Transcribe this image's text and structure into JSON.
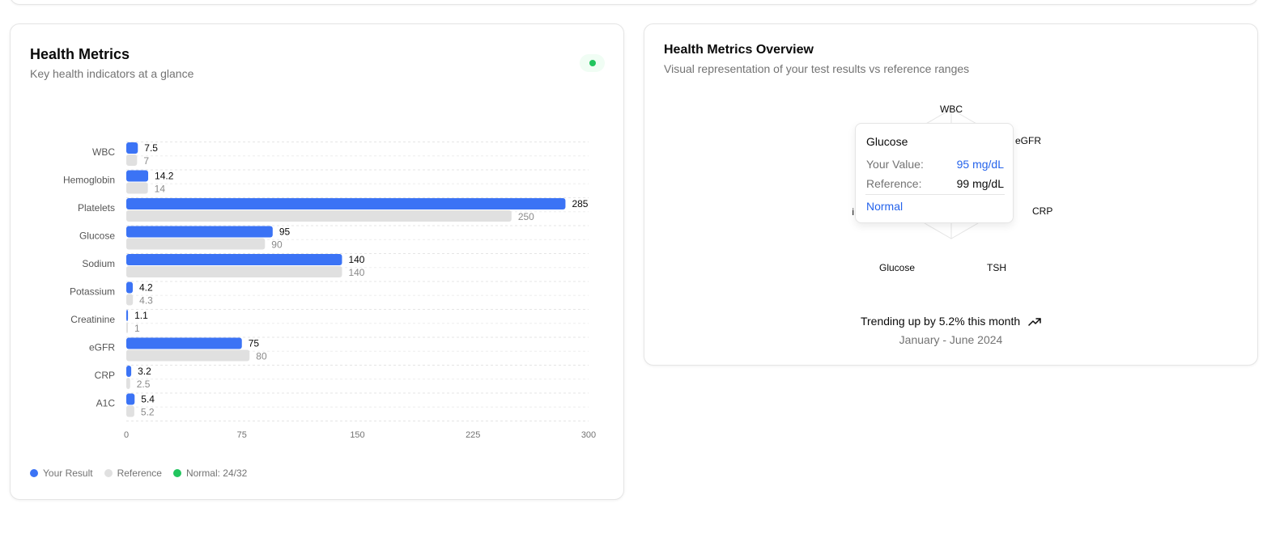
{
  "left_card": {
    "title": "Health Metrics",
    "description": "Key health indicators at a glance",
    "status_color": "#22c55e",
    "legend": {
      "your_result": "Your Result",
      "reference": "Reference",
      "normal": "Normal: 24/32"
    }
  },
  "chart_data": {
    "type": "bar",
    "orientation": "horizontal",
    "categories": [
      "WBC",
      "Hemoglobin",
      "Platelets",
      "Glucose",
      "Sodium",
      "Potassium",
      "Creatinine",
      "eGFR",
      "CRP",
      "A1C"
    ],
    "series": [
      {
        "name": "Your Result",
        "values": [
          7.5,
          14.2,
          285,
          95,
          140,
          4.2,
          1.1,
          75,
          3.2,
          5.4
        ],
        "color": "#3b73f5"
      },
      {
        "name": "Reference",
        "values": [
          7,
          14,
          250,
          90,
          140,
          4.3,
          1,
          80,
          2.5,
          5.2
        ],
        "color": "#e0e0e0"
      }
    ],
    "xlim": [
      0,
      300
    ],
    "xticks": [
      "0",
      "75",
      "150",
      "225",
      "300"
    ],
    "value_labels": {
      "your_result": [
        "7.5",
        "14.2",
        "285",
        "95",
        "140",
        "4.2",
        "1.1",
        "75",
        "3.2",
        "5.4"
      ],
      "reference": [
        "7",
        "14",
        "250",
        "90",
        "140",
        "4.3",
        "1",
        "80",
        "2.5",
        "5.2"
      ]
    },
    "grid": "dashed horizontal"
  },
  "right_card": {
    "title": "Health Metrics Overview",
    "description": "Visual representation of your test results vs reference ranges",
    "radar_axes": [
      "WBC",
      "eGFR",
      "CRP",
      "TSH",
      "Glucose",
      "A1C"
    ],
    "radar_axis_partial_label": "i",
    "tooltip": {
      "title": "Glucose",
      "your_value_label": "Your Value:",
      "your_value": "95 mg/dL",
      "reference_label": "Reference:",
      "reference_value": "99 mg/dL",
      "status": "Normal"
    },
    "trend_text": "Trending up by 5.2% this month",
    "trend_icon": "trending-up-icon",
    "date_range": "January - June 2024",
    "accent_color": "#2563eb"
  }
}
